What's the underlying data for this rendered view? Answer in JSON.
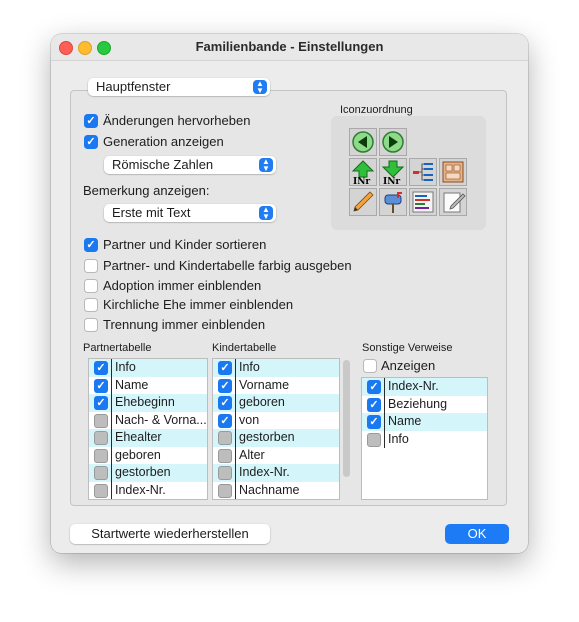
{
  "window": {
    "title": "Familienbande - Einstellungen"
  },
  "section_popup": {
    "value": "Hauptfenster"
  },
  "options": {
    "highlight_changes": {
      "label": "Änderungen hervorheben",
      "checked": true
    },
    "show_generation": {
      "label": "Generation anzeigen",
      "checked": true
    },
    "generation_format": {
      "value": "Römische Zahlen"
    },
    "remark_label": "Bemerkung anzeigen:",
    "remark_format": {
      "value": "Erste mit Text"
    },
    "sort_partners": {
      "label": "Partner und Kinder sortieren",
      "checked": true
    },
    "colored_tables": {
      "label": "Partner- und Kindertabelle farbig ausgeben",
      "checked": false
    },
    "adoption": {
      "label": "Adoption immer einblenden",
      "checked": false
    },
    "church_marriage": {
      "label": "Kirchliche Ehe immer einblenden",
      "checked": false
    },
    "separation": {
      "label": "Trennung immer einblenden",
      "checked": false
    }
  },
  "icons": {
    "heading": "Iconzuordnung",
    "cells": [
      "back-arrow-icon",
      "forward-arrow-icon",
      "up-number-icon",
      "down-number-icon",
      "tree-list-icon",
      "family-book-icon",
      "pencil-icon",
      "mailbox-icon",
      "report-list-icon",
      "notepad-edit-icon"
    ]
  },
  "partner_table": {
    "heading": "Partnertabelle",
    "rows": [
      {
        "label": "Info",
        "checked": true
      },
      {
        "label": "Name",
        "checked": true
      },
      {
        "label": "Ehebeginn",
        "checked": true
      },
      {
        "label": "Nach- & Vorna...",
        "checked": false
      },
      {
        "label": "Ehealter",
        "checked": false
      },
      {
        "label": "geboren",
        "checked": false
      },
      {
        "label": "gestorben",
        "checked": false
      },
      {
        "label": "Index-Nr.",
        "checked": false
      }
    ]
  },
  "children_table": {
    "heading": "Kindertabelle",
    "rows": [
      {
        "label": "Info",
        "checked": true
      },
      {
        "label": "Vorname",
        "checked": true
      },
      {
        "label": "geboren",
        "checked": true
      },
      {
        "label": "von",
        "checked": true
      },
      {
        "label": "gestorben",
        "checked": false
      },
      {
        "label": "Alter",
        "checked": false
      },
      {
        "label": "Index-Nr.",
        "checked": false
      },
      {
        "label": "Nachname",
        "checked": false
      }
    ]
  },
  "other_refs": {
    "heading": "Sonstige Verweise",
    "show": {
      "label": "Anzeigen",
      "checked": false
    },
    "rows": [
      {
        "label": "Index-Nr.",
        "checked": true
      },
      {
        "label": "Beziehung",
        "checked": true
      },
      {
        "label": "Name",
        "checked": true
      },
      {
        "label": "Info",
        "checked": false
      }
    ]
  },
  "buttons": {
    "reset": "Startwerte wiederherstellen",
    "ok": "OK"
  },
  "colors": {
    "accent": "#1a79f0",
    "row_highlight": "#d4f6fa"
  }
}
